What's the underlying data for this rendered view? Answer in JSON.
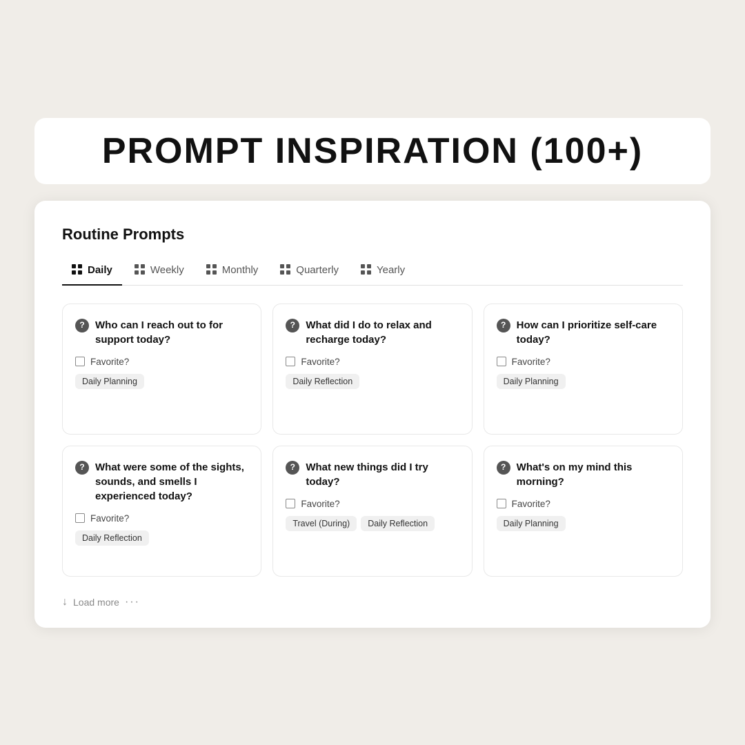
{
  "header": {
    "title": "PROMPT INSPIRATION (100+)"
  },
  "panel": {
    "title": "Routine Prompts"
  },
  "tabs": [
    {
      "label": "Daily",
      "active": true
    },
    {
      "label": "Weekly",
      "active": false
    },
    {
      "label": "Monthly",
      "active": false
    },
    {
      "label": "Quarterly",
      "active": false
    },
    {
      "label": "Yearly",
      "active": false
    }
  ],
  "cards": [
    {
      "question": "Who can I reach out to for support today?",
      "favorite_label": "Favorite?",
      "tags": [
        "Daily Planning"
      ]
    },
    {
      "question": "What did I do to relax and recharge today?",
      "favorite_label": "Favorite?",
      "tags": [
        "Daily Reflection"
      ]
    },
    {
      "question": "How can I prioritize self-care today?",
      "favorite_label": "Favorite?",
      "tags": [
        "Daily Planning"
      ]
    },
    {
      "question": "What were some of the sights, sounds, and smells I experienced today?",
      "favorite_label": "Favorite?",
      "tags": [
        "Daily Reflection"
      ]
    },
    {
      "question": "What new things did I try today?",
      "favorite_label": "Favorite?",
      "tags": [
        "Travel (During)",
        "Daily Reflection"
      ]
    },
    {
      "question": "What's on my mind this morning?",
      "favorite_label": "Favorite?",
      "tags": [
        "Daily Planning"
      ]
    }
  ],
  "load_more": {
    "label": "Load more",
    "arrow": "↓",
    "dots": "···"
  }
}
